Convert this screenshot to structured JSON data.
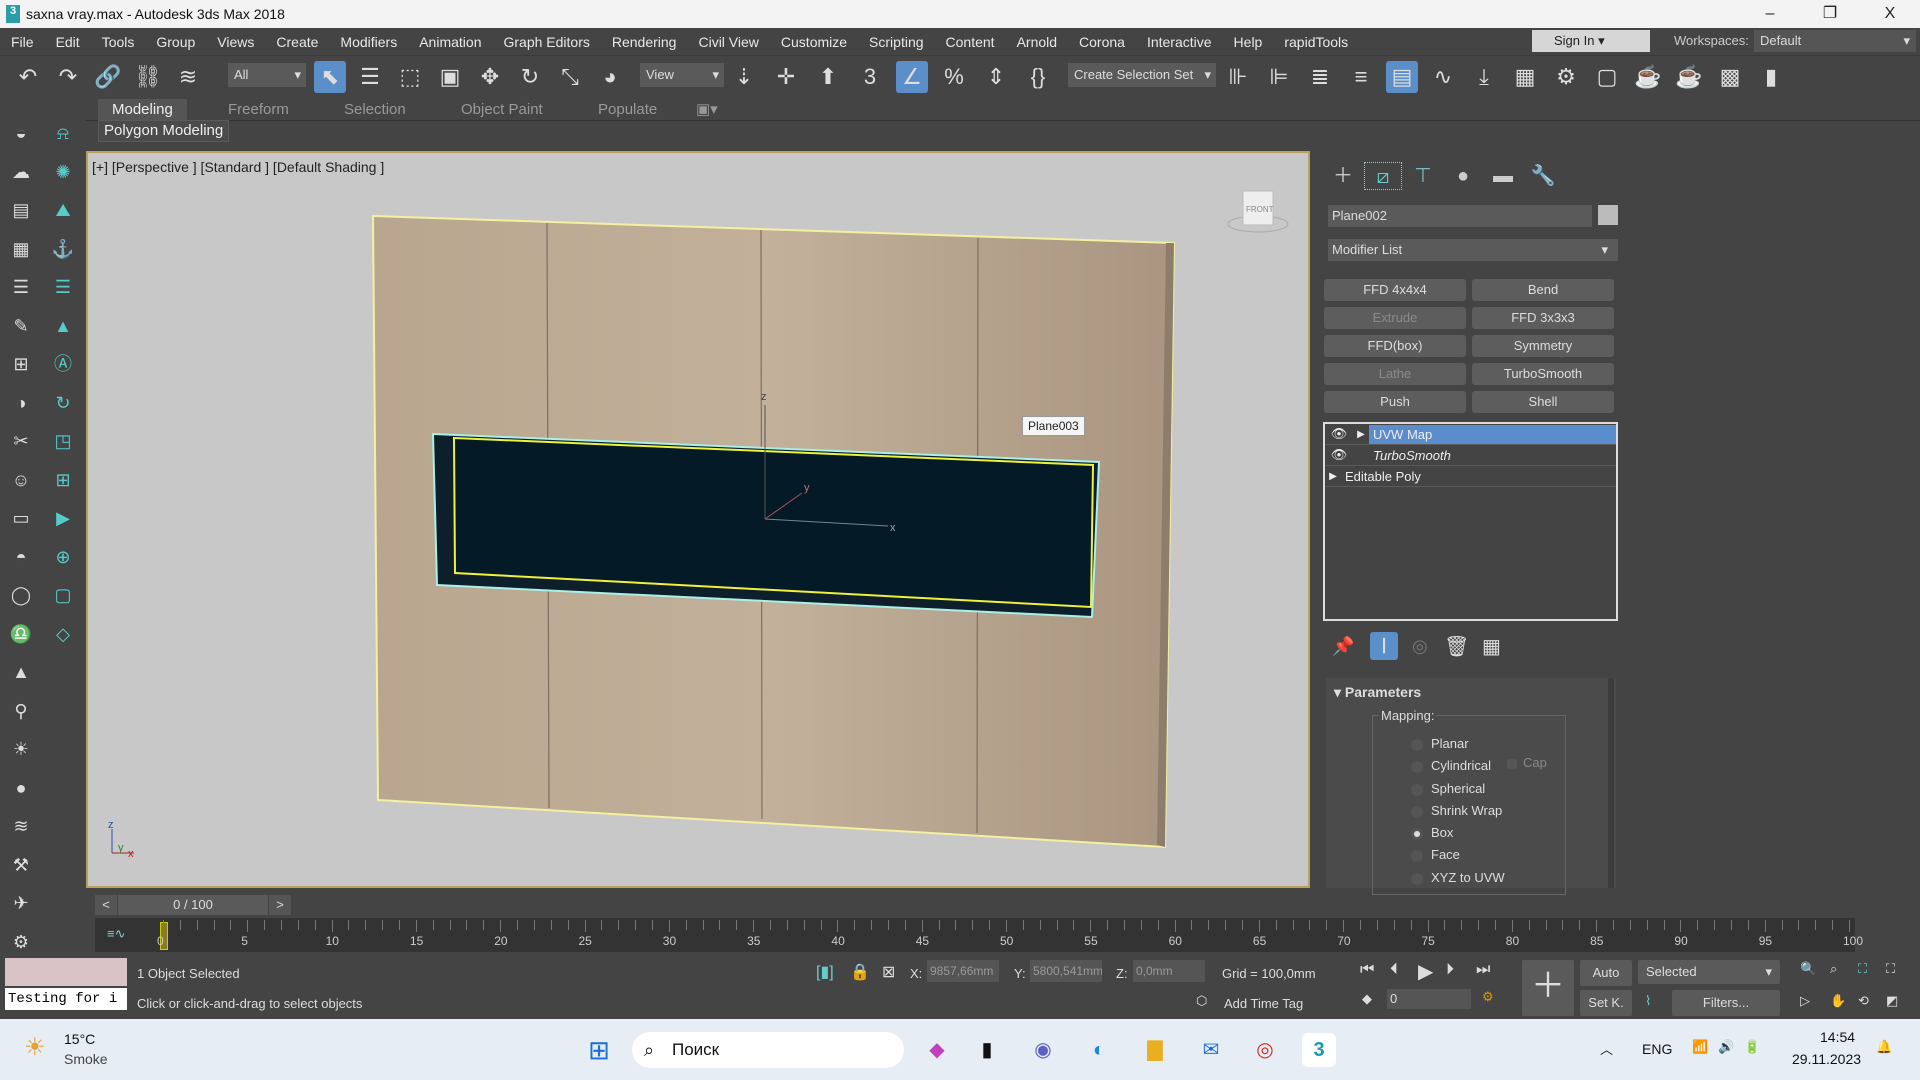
{
  "window": {
    "title": "saxna vray.max - Autodesk 3ds Max 2018",
    "minimize": "–",
    "restore": "❐",
    "close": "X",
    "app_icon": "3"
  },
  "menu": [
    "File",
    "Edit",
    "Tools",
    "Group",
    "Views",
    "Create",
    "Modifiers",
    "Animation",
    "Graph Editors",
    "Rendering",
    "Civil View",
    "Customize",
    "Scripting",
    "Content",
    "Arnold",
    "Corona",
    "Interactive",
    "Help",
    "rapidTools"
  ],
  "account": {
    "sign_in": "Sign In",
    "workspaces_label": "Workspaces:",
    "workspace": "Default"
  },
  "toolbar": {
    "selection_filter": "All",
    "ref_coord": "View",
    "selection_set": "Create Selection Set",
    "icons": [
      {
        "name": "undo-icon",
        "g": "↶"
      },
      {
        "name": "redo-icon",
        "g": "↷"
      },
      {
        "name": "link-icon",
        "g": "🔗"
      },
      {
        "name": "unlink-icon",
        "g": "⛓"
      },
      {
        "name": "bind-space-warp-icon",
        "g": "≋"
      }
    ],
    "icons2": [
      {
        "name": "select-object-icon",
        "g": "⬉",
        "on": true
      },
      {
        "name": "select-by-name-icon",
        "g": "☰"
      },
      {
        "name": "rect-selection-icon",
        "g": "⬚"
      },
      {
        "name": "window-crossing-icon",
        "g": "▣"
      },
      {
        "name": "move-icon",
        "g": "✥"
      },
      {
        "name": "rotate-icon",
        "g": "↻"
      },
      {
        "name": "scale-icon",
        "g": "⤡"
      },
      {
        "name": "place-icon",
        "g": "◕"
      }
    ],
    "icons3": [
      {
        "name": "pivot-icon",
        "g": "⇣"
      },
      {
        "name": "select-manipulate-icon",
        "g": "✛"
      },
      {
        "name": "keyboard-shortcut-icon",
        "g": "⬆",
        "on": false
      },
      {
        "name": "snap-3d-icon",
        "g": "3"
      },
      {
        "name": "angle-snap-icon",
        "g": "∠",
        "on": true
      },
      {
        "name": "percent-snap-icon",
        "g": "%"
      },
      {
        "name": "spinner-snap-icon",
        "g": "⇕"
      },
      {
        "name": "named-sets-icon",
        "g": "{}"
      }
    ],
    "icons4": [
      {
        "name": "mirror-icon",
        "g": "⊪"
      },
      {
        "name": "align-icon",
        "g": "⊫"
      },
      {
        "name": "layer-manager-icon",
        "g": "≣"
      },
      {
        "name": "scene-explorer-icon",
        "g": "≡"
      },
      {
        "name": "ribbon-toggle-icon",
        "g": "▤",
        "on": true
      },
      {
        "name": "curve-editor-icon",
        "g": "∿"
      },
      {
        "name": "dope-sheet-icon",
        "g": "⤓"
      },
      {
        "name": "material-editor-icon",
        "g": "▦"
      },
      {
        "name": "render-setup-icon",
        "g": "⚙"
      },
      {
        "name": "rendered-frame-icon",
        "g": "▢"
      },
      {
        "name": "render-icon",
        "g": "☕"
      },
      {
        "name": "render-iterative-icon",
        "g": "☕"
      },
      {
        "name": "render-cloud-icon",
        "g": "▩"
      },
      {
        "name": "a360-icon",
        "g": "▮"
      }
    ]
  },
  "ribbon": {
    "tabs": [
      "Modeling",
      "Freeform",
      "Selection",
      "Object Paint",
      "Populate"
    ],
    "panel": "Polygon Modeling"
  },
  "viewport": {
    "label": "[+] [Perspective ] [Standard ] [Default Shading ]",
    "object_label": "Plane003",
    "viewcube": "FRONT",
    "axes": {
      "x": "x",
      "y": "y",
      "z": "z"
    }
  },
  "command_panel": {
    "object_name": "Plane002",
    "modifier_list": "Modifier List",
    "mod_buttons": [
      {
        "l": "FFD 4x4x4"
      },
      {
        "l": "Bend"
      },
      {
        "l": "Extrude",
        "dis": true
      },
      {
        "l": "FFD 3x3x3"
      },
      {
        "l": "FFD(box)"
      },
      {
        "l": "Symmetry"
      },
      {
        "l": "Lathe",
        "dis": true
      },
      {
        "l": "TurboSmooth"
      },
      {
        "l": "Push"
      },
      {
        "l": "Shell"
      }
    ],
    "stack": [
      "UVW Map",
      "TurboSmooth",
      "Editable Poly"
    ],
    "rollout": "Parameters",
    "mapping_label": "Mapping:",
    "cap": "Cap",
    "mapping": [
      "Planar",
      "Cylindrical",
      "Spherical",
      "Shrink Wrap",
      "Box",
      "Face",
      "XYZ to UVW"
    ],
    "mapping_selected": "Box"
  },
  "timeline": {
    "frame": "0 / 100",
    "ticks": [
      0,
      5,
      10,
      15,
      20,
      25,
      30,
      35,
      40,
      45,
      50,
      55,
      60,
      65,
      70,
      75,
      80,
      85,
      90,
      95,
      100
    ],
    "current": 0,
    "prev": "<",
    "next": ">"
  },
  "status": {
    "listener": "Testing for i",
    "selected": "1 Object Selected",
    "prompt": "Click or click-and-drag to select objects",
    "x": "9857,66mm",
    "y": "5800,541mm",
    "z": "0,0mm",
    "xl": "X:",
    "yl": "Y:",
    "zl": "Z:",
    "grid": "Grid = 100,0mm",
    "add_time_tag": "Add Time Tag",
    "auto": "Auto",
    "set_key": "Set K.",
    "key_filter": "Selected",
    "filters": "Filters...",
    "frame_field": "0"
  },
  "taskbar": {
    "temp": "15°C",
    "weather": "Smoke",
    "search": "Поиск",
    "lang": "ENG",
    "time": "14:54",
    "date": "29.11.2023"
  }
}
